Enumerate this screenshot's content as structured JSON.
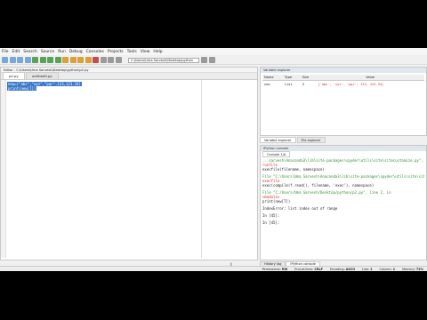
{
  "menu": [
    "File",
    "Edit",
    "Search",
    "Source",
    "Run",
    "Debug",
    "Consoles",
    "Projects",
    "Tools",
    "View",
    "Help"
  ],
  "toolbar": {
    "path": "C:\\Users\\Uma Sarvesh\\Desktop\\python"
  },
  "editor": {
    "header": "Editor - C:\\Users\\Uma Sarvesh\\Desktop\\python\\p2.py",
    "filepath": "C:\\Users\\Uma Sarvesh\\Desktop\\python\\p2.py",
    "tabs": [
      "p2.py",
      "untitled0.py"
    ],
    "code_lines": [
      "new=[\"abc\",\"xyz\",\"pqr\",123,123.34]",
      "print(new[7])"
    ]
  },
  "variable_explorer": {
    "header": "Variable explorer",
    "columns": [
      "Name",
      "Type",
      "Size",
      "Value"
    ],
    "rows": [
      {
        "name": "new",
        "type": "list",
        "size": "5",
        "value": "['abc', 'xyz', 'pqr', 123, 123.34]"
      }
    ],
    "tabs": [
      "Variable explorer",
      "File explorer"
    ]
  },
  "console": {
    "header": "IPython console",
    "tab": "Console 1/A",
    "lines": [
      {
        "text": "...sarvesh\\Anaconda3\\lib\\site-packages\\spyder\\utils\\site\\sitecustomize.py\", line 877, in",
        "cls": "green"
      },
      {
        "text": "runfile",
        "cls": "red"
      },
      {
        "text": "    execfile(filename, namespace)",
        "cls": "dark"
      },
      {
        "text": "",
        "cls": "gap"
      },
      {
        "text": "  File \"C:\\Users\\Uma Sarvesh\\Anaconda3\\lib\\site-packages\\spyder\\utils\\site\\sitecustomize.py\", line 110, in",
        "cls": "green"
      },
      {
        "text": "execfile",
        "cls": "red"
      },
      {
        "text": "    exec(compile(f.read(), filename, 'exec'), namespace)",
        "cls": "dark"
      },
      {
        "text": "",
        "cls": "gap"
      },
      {
        "text": "  File \"C:/Users/Uma Sarvesh/Desktop/python/p2.py\", line 2, in",
        "cls": "green"
      },
      {
        "text": "<module>",
        "cls": "red"
      },
      {
        "text": "    print(new[7])",
        "cls": "dark"
      },
      {
        "text": "",
        "cls": "gap"
      },
      {
        "text": "IndexError: list index out of range",
        "cls": "dark"
      },
      {
        "text": "",
        "cls": "gap"
      },
      {
        "text": "In [45]:",
        "cls": "dark"
      },
      {
        "text": "",
        "cls": "gap"
      },
      {
        "text": "In [45]:",
        "cls": "dark"
      }
    ]
  },
  "bottom_tabs": [
    "History log",
    "IPython console"
  ],
  "status": {
    "permissions_label": "Permissions:",
    "permissions": "RW",
    "eol_label": "End-of-lines:",
    "eol": "CRLF",
    "encoding_label": "Encoding:",
    "encoding": "ASCII",
    "line_label": "Line:",
    "line": "1",
    "column_label": "Column:",
    "column": "1",
    "memory_label": "Memory:",
    "memory": "72%"
  },
  "colors": {
    "selection": "#3a78c9",
    "trace_green": "#2f8f2f",
    "trace_red": "#c8321e"
  }
}
